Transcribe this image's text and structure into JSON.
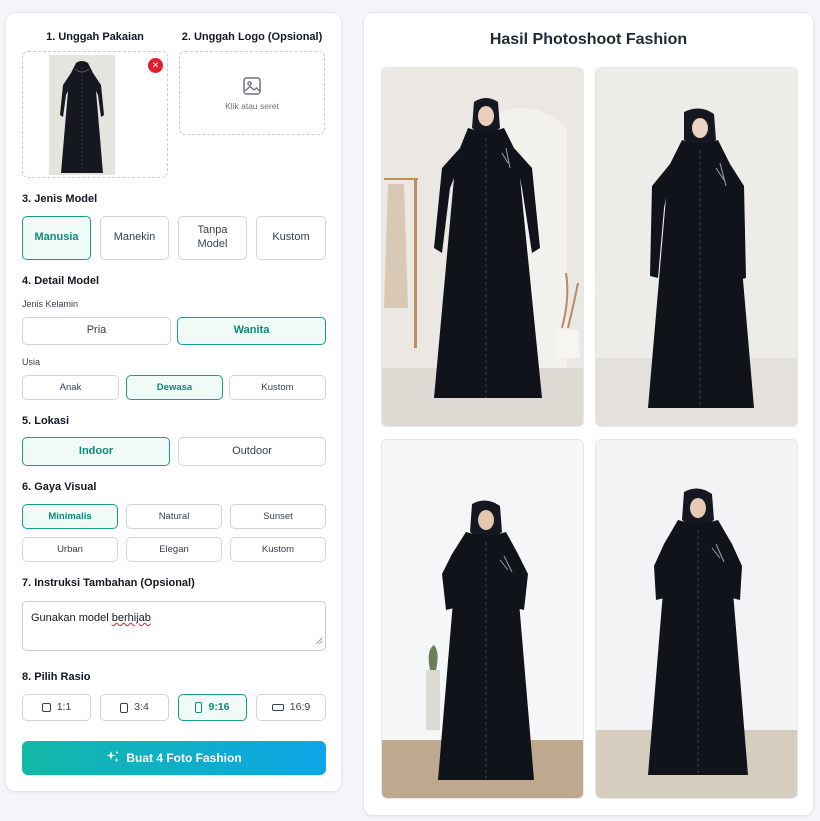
{
  "upload": {
    "clothing_title": "1. Unggah Pakaian",
    "logo_title": "2. Unggah Logo (Opsional)",
    "logo_hint": "Klik atau seret",
    "remove_icon": "close-icon"
  },
  "model_type": {
    "title": "3. Jenis Model",
    "options": [
      "Manusia",
      "Manekin",
      "Tanpa Model",
      "Kustom"
    ],
    "selected": "Manusia"
  },
  "model_detail": {
    "title": "4. Detail Model",
    "gender_label": "Jenis Kelamin",
    "gender_options": [
      "Pria",
      "Wanita"
    ],
    "gender_selected": "Wanita",
    "age_label": "Usia",
    "age_options": [
      "Anak",
      "Dewasa",
      "Kustom"
    ],
    "age_selected": "Dewasa"
  },
  "location": {
    "title": "5. Lokasi",
    "options": [
      "Indoor",
      "Outdoor"
    ],
    "selected": "Indoor"
  },
  "visual_style": {
    "title": "6. Gaya Visual",
    "options": [
      "Minimalis",
      "Natural",
      "Sunset",
      "Urban",
      "Elegan",
      "Kustom"
    ],
    "selected": "Minimalis"
  },
  "instructions": {
    "title": "7. Instruksi Tambahan (Opsional)",
    "value_prefix": "Gunakan model ",
    "value_flagged": "berhijab"
  },
  "ratio": {
    "title": "8. Pilih Rasio",
    "options": [
      "1:1",
      "3:4",
      "9:16",
      "16:9"
    ],
    "selected": "9:16"
  },
  "generate_button": {
    "label": "Buat 4 Foto Fashion",
    "icon": "sparkles-icon"
  },
  "results": {
    "title": "Hasil Photoshoot Fashion",
    "photo_count": 4
  },
  "colors": {
    "accent": "#14a08b",
    "button_gradient_start": "#14b8a6",
    "button_gradient_end": "#0ea5e9",
    "remove": "#e11d2e"
  }
}
